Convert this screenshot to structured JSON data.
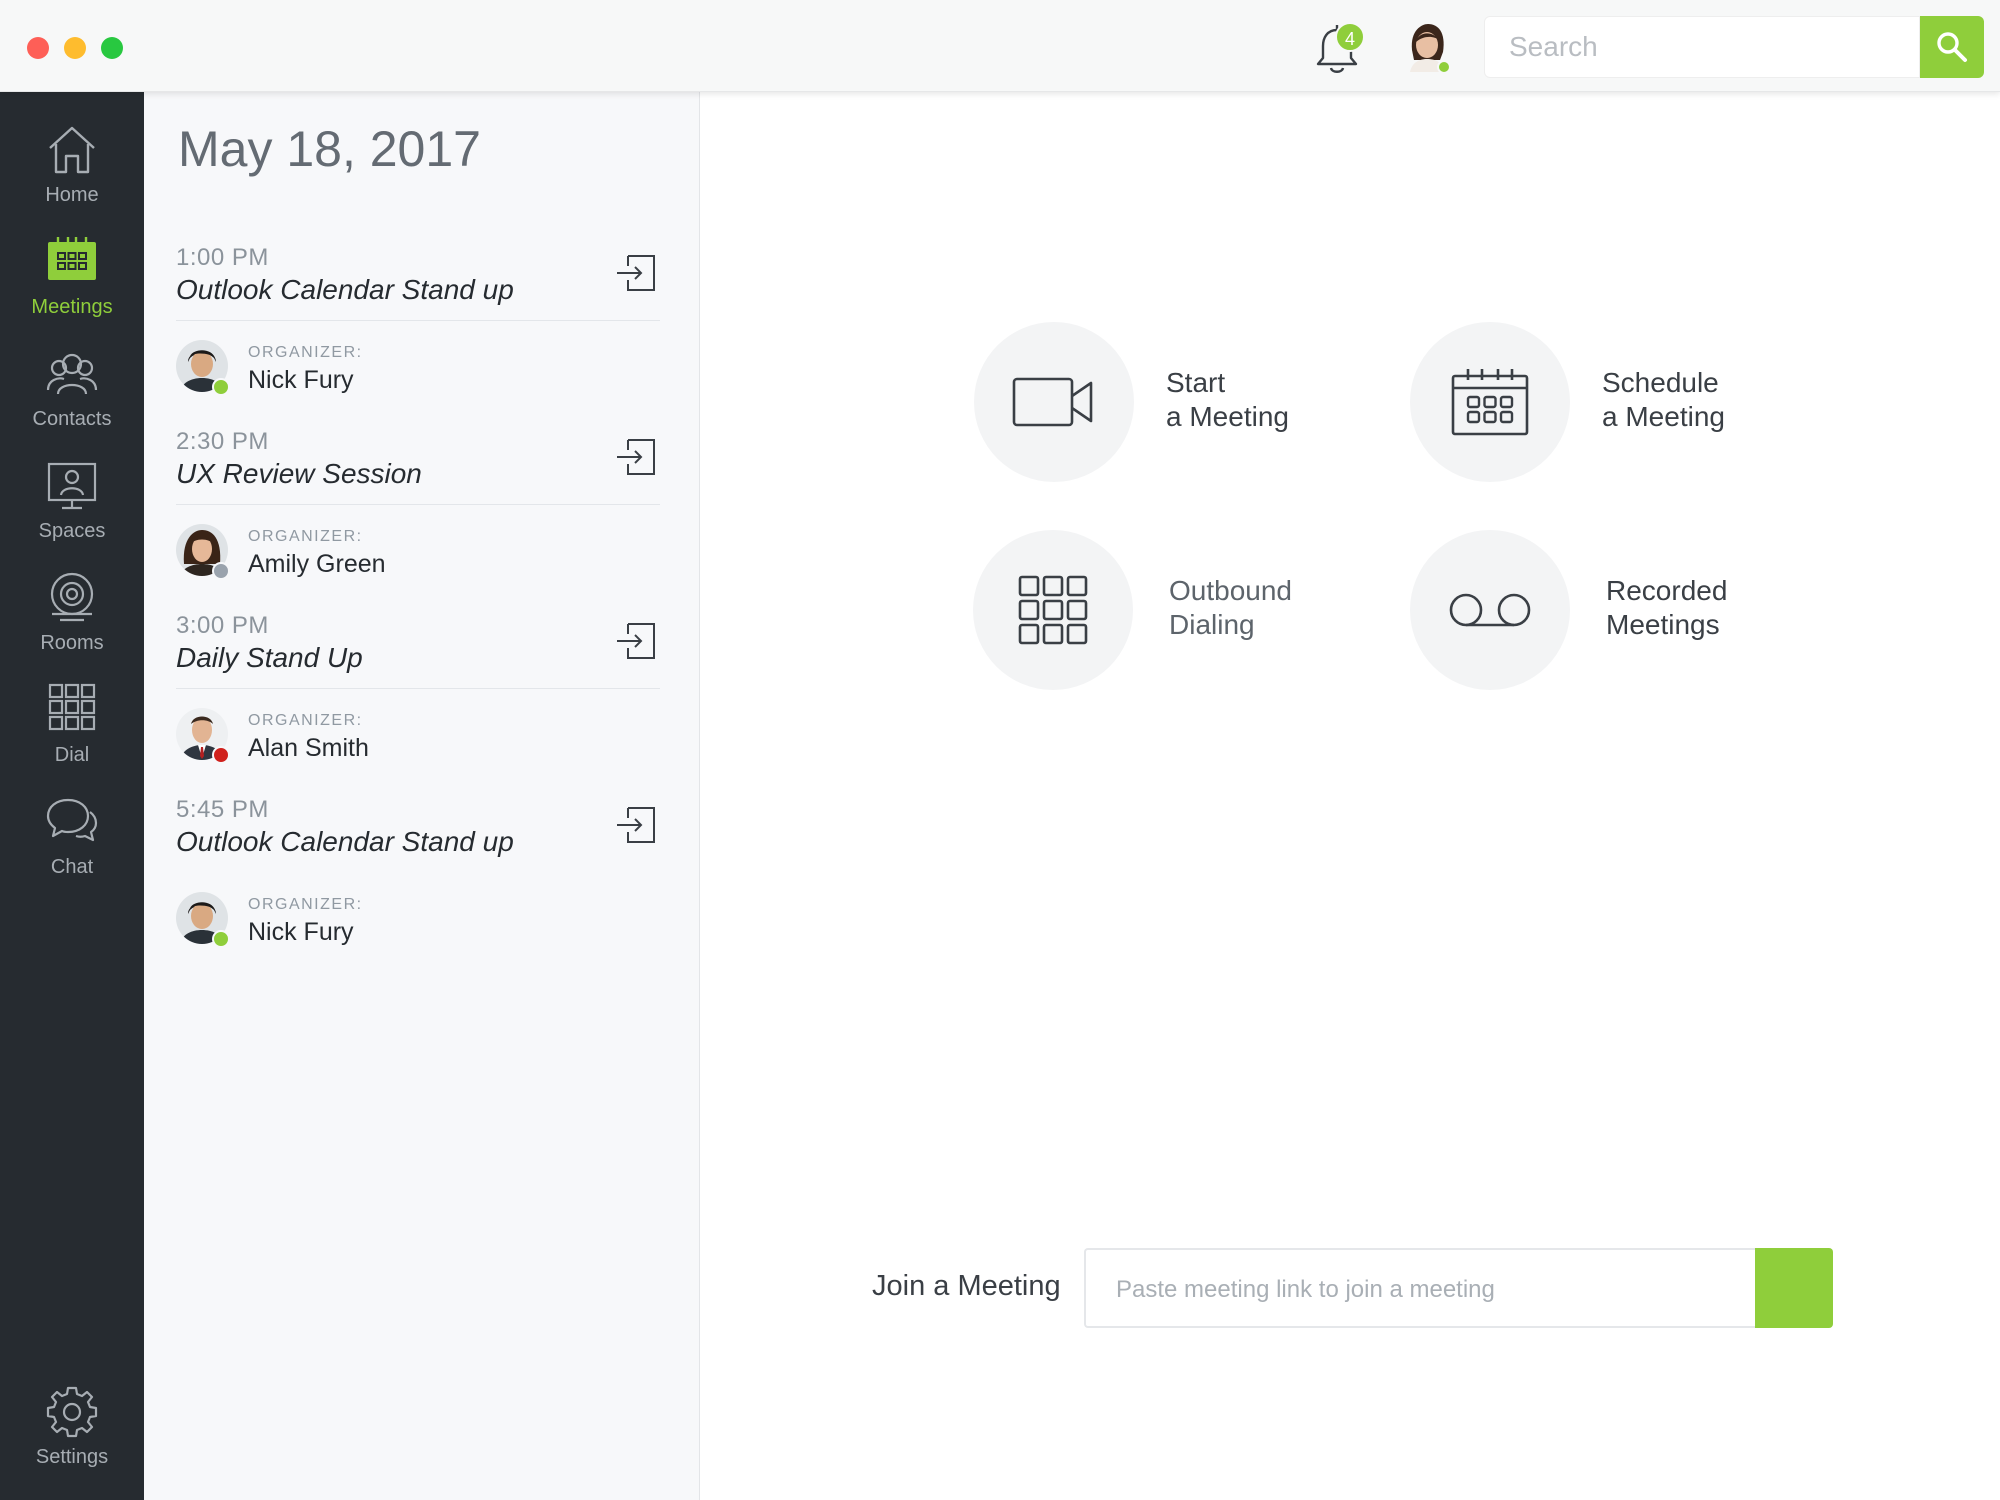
{
  "titlebar": {
    "notification_count": "4",
    "search": {
      "placeholder": "Search"
    }
  },
  "sidebar": {
    "items": [
      {
        "label": "Home",
        "icon": "home-icon"
      },
      {
        "label": "Meetings",
        "icon": "calendar-icon",
        "active": true
      },
      {
        "label": "Contacts",
        "icon": "contacts-icon"
      },
      {
        "label": "Spaces",
        "icon": "spaces-icon"
      },
      {
        "label": "Rooms",
        "icon": "rooms-icon"
      },
      {
        "label": "Dial",
        "icon": "dialpad-icon"
      },
      {
        "label": "Chat",
        "icon": "chat-icon"
      }
    ],
    "settings_label": "Settings"
  },
  "agenda": {
    "date": "May 18, 2017",
    "meetings": [
      {
        "time": "1:00 PM",
        "title": "Outlook Calendar Stand up",
        "organizer_label": "ORGANIZER:",
        "organizer": "Nick Fury",
        "status_color": "#8fce3b"
      },
      {
        "time": "2:30 PM",
        "title": "UX Review Session",
        "organizer_label": "ORGANIZER:",
        "organizer": "Amily Green",
        "status_color": "#9aa3ad"
      },
      {
        "time": "3:00 PM",
        "title": "Daily Stand Up",
        "organizer_label": "ORGANIZER:",
        "organizer": "Alan Smith",
        "status_color": "#d0211c"
      },
      {
        "time": "5:45 PM",
        "title": "Outlook Calendar Stand up",
        "organizer_label": "ORGANIZER:",
        "organizer": "Nick Fury",
        "status_color": "#8fce3b"
      }
    ]
  },
  "actions": {
    "start": {
      "line1": "Start",
      "line2": "a Meeting",
      "icon": "video-camera-icon"
    },
    "schedule": {
      "line1": "Schedule",
      "line2": "a Meeting",
      "icon": "calendar-icon"
    },
    "outbound": {
      "line1": "Outbound",
      "line2": "Dialing",
      "icon": "dialpad-icon"
    },
    "recorded": {
      "line1": "Recorded",
      "line2": "Meetings",
      "icon": "voicemail-icon"
    }
  },
  "join": {
    "label": "Join a Meeting",
    "placeholder": "Paste meeting link to join a meeting"
  },
  "colors": {
    "accent": "#8fce3b",
    "sidebar_bg": "#262b30"
  }
}
